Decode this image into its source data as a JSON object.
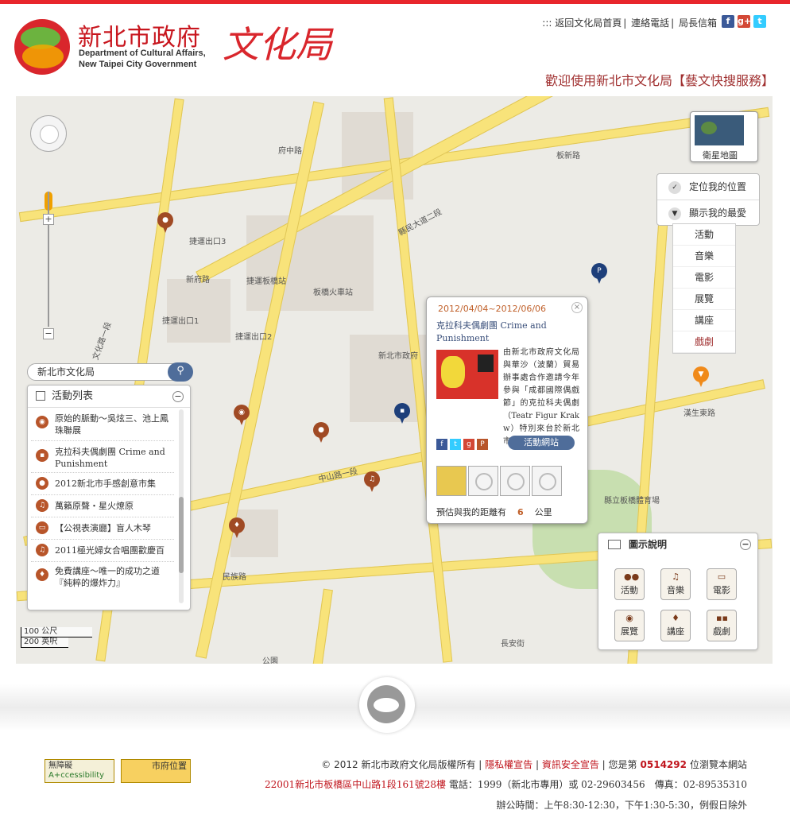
{
  "header": {
    "logo_cn": "新北市政府",
    "logo_en_1": "Department of Cultural Affairs,",
    "logo_en_2": "New Taipei City Government",
    "logo_calligraphy": "文化局",
    "links": [
      "::: 返回文化局首頁",
      "連絡電話",
      "局長信箱"
    ],
    "welcome": "歡迎使用新北市文化局【藝文快搜服務】"
  },
  "map": {
    "satellite_label": "衛星地圖",
    "locate_label": "定位我的位置",
    "favorites_label": "顯示我的最愛",
    "favorites_menu": [
      "活動",
      "音樂",
      "電影",
      "展覽",
      "講座",
      "戲劇"
    ],
    "search_value": "新北市文化局",
    "scale_1": "100 公尺",
    "scale_2": "200 英呎",
    "labels": [
      "捷運板橋站",
      "板橋火車站",
      "新北市政府",
      "縣民大道二段",
      "中山路一段",
      "新府路",
      "民族路",
      "文化路一段",
      "漢生東路",
      "府中路",
      "板新路",
      "捷運出口3",
      "捷運出口1",
      "捷運出口2",
      "縣立板橋體育場",
      "長安街",
      "公園"
    ]
  },
  "activity_list": {
    "title": "活動列表",
    "items": [
      {
        "icon": "camera",
        "text": "原始的脈動～吳炫三、池上鳳珠聯展"
      },
      {
        "icon": "drama",
        "text": "克拉科夫偶劇團 Crime and Punishment"
      },
      {
        "icon": "people",
        "text": "2012新北市手感創意市集"
      },
      {
        "icon": "music",
        "text": "萬籟原聲・星火燎原"
      },
      {
        "icon": "film",
        "text": "【公視表演廳】盲人木琴"
      },
      {
        "icon": "music",
        "text": "2011極光婦女合唱團歡慶百"
      },
      {
        "icon": "mic",
        "text": "免費講座～唯一的成功之道『純粹的爆炸力』"
      }
    ]
  },
  "popup": {
    "date": "2012/04/04~2012/06/06",
    "title": "克拉科夫偶劇團 Crime and Punishment",
    "description": "由新北市政府文化局與華沙（波蘭）貿易辦事處合作邀請今年參與「成都國際偶戲節」的克拉科夫偶劇（Teatr Figur Krak w）特別來台於新北市…",
    "site_button": "活動網站",
    "distance_prefix": "預估與我的距離有",
    "distance_value": "6",
    "distance_unit": "公里"
  },
  "legend": {
    "title": "圖示說明",
    "items": [
      "活動",
      "音樂",
      "電影",
      "展覽",
      "講座",
      "戲劇"
    ]
  },
  "footer": {
    "badge1_a": "無障礙",
    "badge1_b": "A+ccessibility",
    "badge2": "市府位置",
    "copyright": "© 2012 新北市政府文化局版權所有",
    "privacy": "隱私權宣告",
    "security": "資訊安全宣告",
    "visitor_prefix": "您是第",
    "visitor_count": "0514292",
    "visitor_suffix": "位瀏覽本網站",
    "address": "22001新北市板橋區中山路1段161號28樓",
    "phone": "電話：1999（新北市專用）或 02-29603456　傳真：02-89535310",
    "hours": "辦公時間：上午8:30-12:30，下午1:30-5:30，例假日除外"
  }
}
